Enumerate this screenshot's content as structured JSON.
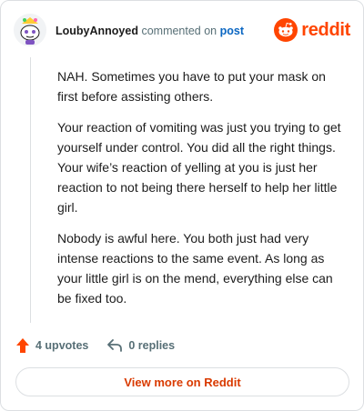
{
  "comment": {
    "username": "LoubyAnnoyed",
    "action_text": "commented on",
    "post_link_text": "post",
    "paragraphs": [
      "NAH. Sometimes you have to put your mask on first before assisting others.",
      "Your reaction of vomiting was just you trying to get yourself under control. You did all the right things. Your wife’s reaction of yelling at you is just her reaction to not being there herself to help her little girl.",
      "Nobody is awful here. You both just had very intense reactions to the same event. As long as your little girl is on the mend, everything else can be fixed too."
    ]
  },
  "brand": {
    "name": "reddit",
    "icon": "reddit-logo-icon",
    "color": "#ff4500"
  },
  "actions": {
    "upvotes_label": "4 upvotes",
    "upvote_icon": "upvote-arrow-icon",
    "replies_label": "0 replies",
    "reply_icon": "reply-icon"
  },
  "footer": {
    "view_more_label": "View more on Reddit"
  },
  "colors": {
    "upvote": "#ff4500",
    "link": "#0a66c2",
    "view_more": "#d93a00",
    "muted": "#576f76"
  }
}
